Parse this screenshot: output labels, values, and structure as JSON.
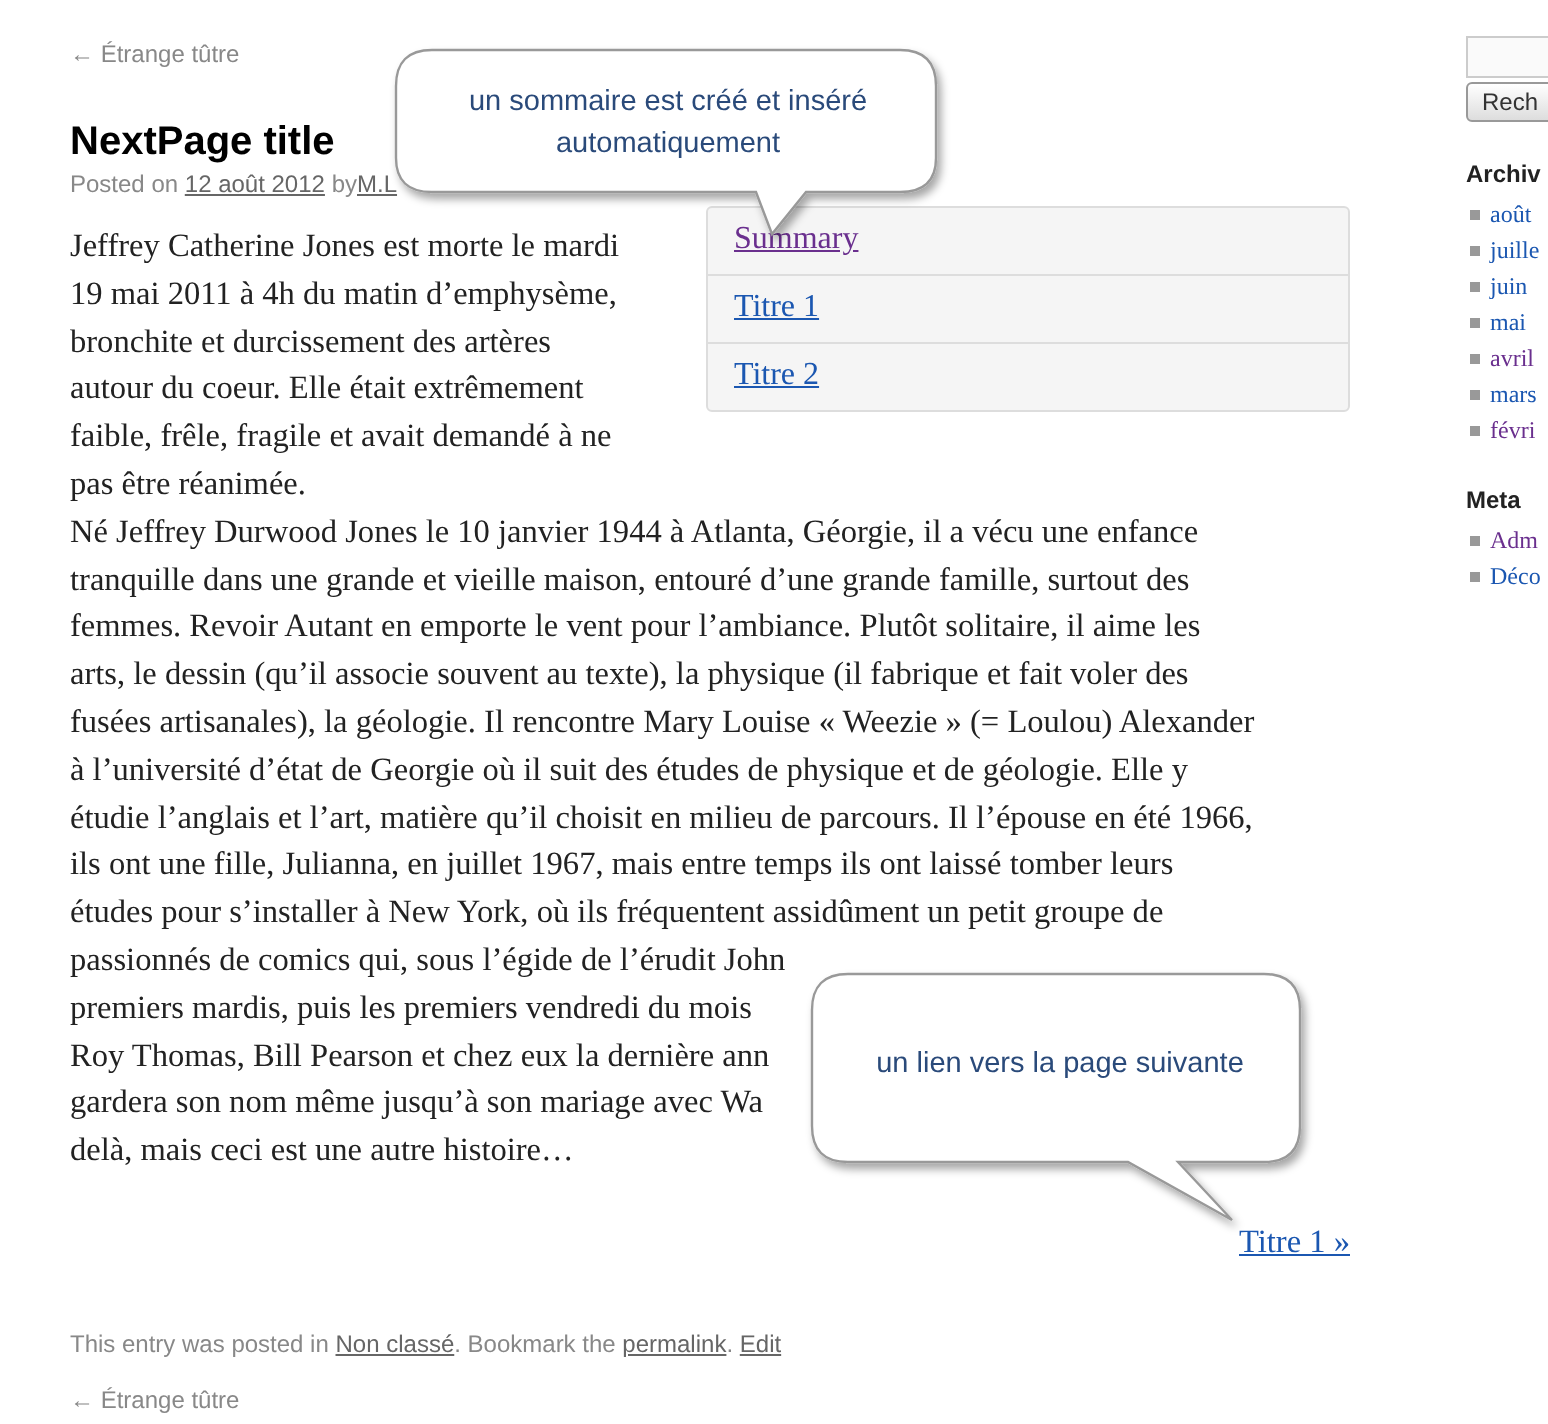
{
  "nav_previous": "← Étrange tûtre",
  "post": {
    "title": "NextPage title",
    "meta_prefix": "Posted on",
    "date": "12 août 2012",
    "meta_by": "by",
    "author": "M.L",
    "toc": [
      {
        "label": "Summary",
        "visited": true
      },
      {
        "label": "Titre 1",
        "visited": false
      },
      {
        "label": "Titre 2",
        "visited": false
      }
    ],
    "paragraphs": [
      [
        "Jeffrey Catherine Jones est morte le mardi",
        "19 mai 2011 à 4h du matin d’emphysème,",
        "bronchite et durcissement des artères",
        "autour du coeur. Elle était extrêmement",
        "faible, frêle, fragile et avait demandé à ne",
        "pas être réanimée."
      ],
      [
        "Né Jeffrey Durwood Jones le 10 janvier 1944 à Atlanta, Géorgie, il a vécu une enfance",
        "tranquille dans une grande et vieille maison, entouré d’une grande famille, surtout des",
        "femmes. Revoir Autant en emporte le vent pour l’ambiance. Plutôt solitaire, il aime les",
        "arts, le dessin (qu’il associe souvent au texte), la physique (il fabrique et fait voler des",
        "fusées artisanales), la géologie. Il rencontre Mary Louise « Weezie » (= Loulou) Alexander",
        "à l’université d’état de Georgie où il suit des études de physique et de géologie. Elle y",
        "étudie l’anglais et l’art, matière qu’il choisit en milieu de parcours. Il l’épouse en été 1966,",
        "ils ont une fille, Julianna, en juillet 1967, mais entre temps ils ont laissé tomber leurs",
        "études pour s’installer à New York, où ils fréquentent assidûment un petit groupe de",
        "passionnés de comics qui, sous l’égide de l’érudit John",
        "premiers mardis, puis les premiers vendredi du mois",
        "Roy Thomas, Bill Pearson et chez eux la dernière ann",
        "gardera son nom même jusqu’à son mariage avec Wa",
        "delà, mais ceci est une autre histoire…"
      ]
    ],
    "next_page_link": "Titre 1 »",
    "footer": {
      "prefix": "This entry was posted in",
      "category": "Non classé",
      "middle": ". Bookmark the",
      "permalink": "permalink",
      "dot": ".",
      "edit": "Edit"
    }
  },
  "nav_previous_bottom": "← Étrange tûtre",
  "callouts": [
    {
      "text": "un sommaire est créé et inséré automatiquement"
    },
    {
      "text": "un lien vers la page suivante"
    }
  ],
  "sidebar": {
    "search_button": "Rech",
    "widgets": [
      {
        "title": "Archiv",
        "items": [
          {
            "label": "août",
            "visited": false
          },
          {
            "label": "juille",
            "visited": false
          },
          {
            "label": "juin",
            "visited": false
          },
          {
            "label": "mai",
            "visited": false
          },
          {
            "label": "avril",
            "visited": true
          },
          {
            "label": "mars",
            "visited": false
          },
          {
            "label": "févri",
            "visited": true
          }
        ]
      },
      {
        "title": "Meta",
        "items": [
          {
            "label": "Adm",
            "visited": true
          },
          {
            "label": "Déco",
            "visited": false
          }
        ]
      }
    ]
  }
}
